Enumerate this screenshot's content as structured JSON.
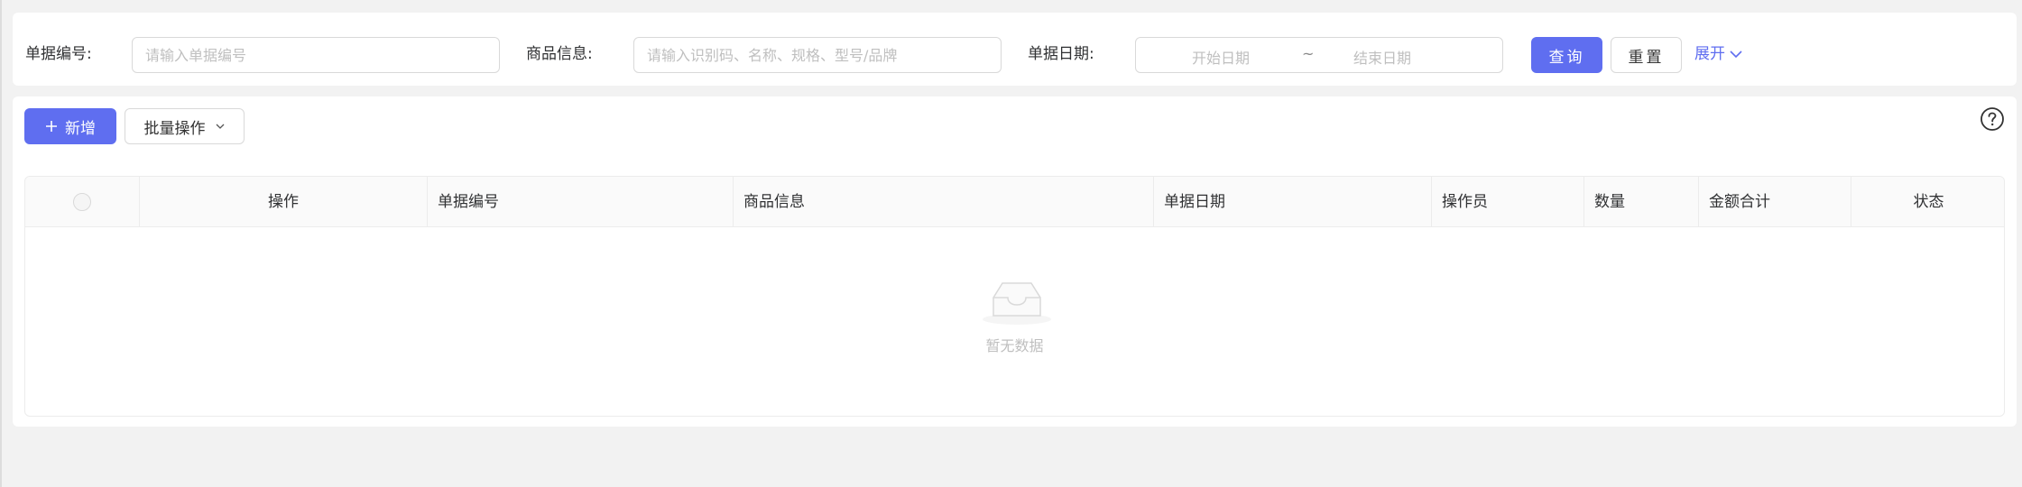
{
  "filters": {
    "doc_no_label": "单据编号:",
    "doc_no_placeholder": "请输入单据编号",
    "product_label": "商品信息:",
    "product_placeholder": "请输入识别码、名称、规格、型号/品牌",
    "date_label": "单据日期:",
    "date_start_placeholder": "开始日期",
    "date_separator": "~",
    "date_end_placeholder": "结束日期",
    "query_label": "查询",
    "reset_label": "重置",
    "expand_label": "展开"
  },
  "toolbar": {
    "add_label": "新增",
    "batch_label": "批量操作"
  },
  "table": {
    "columns": [
      "操作",
      "单据编号",
      "商品信息",
      "单据日期",
      "操作员",
      "数量",
      "金额合计",
      "状态"
    ],
    "rows": [],
    "empty_text": "暂无数据"
  },
  "icons": {
    "help": "question-circle-icon",
    "plus": "plus-icon",
    "chevron": "chevron-down-icon",
    "empty": "empty-inbox-icon"
  },
  "colors": {
    "primary": "#5f6ef0",
    "background": "#f2f2f2",
    "panel": "#ffffff",
    "border": "#d9d9d9",
    "placeholder": "#bfbfbf"
  }
}
